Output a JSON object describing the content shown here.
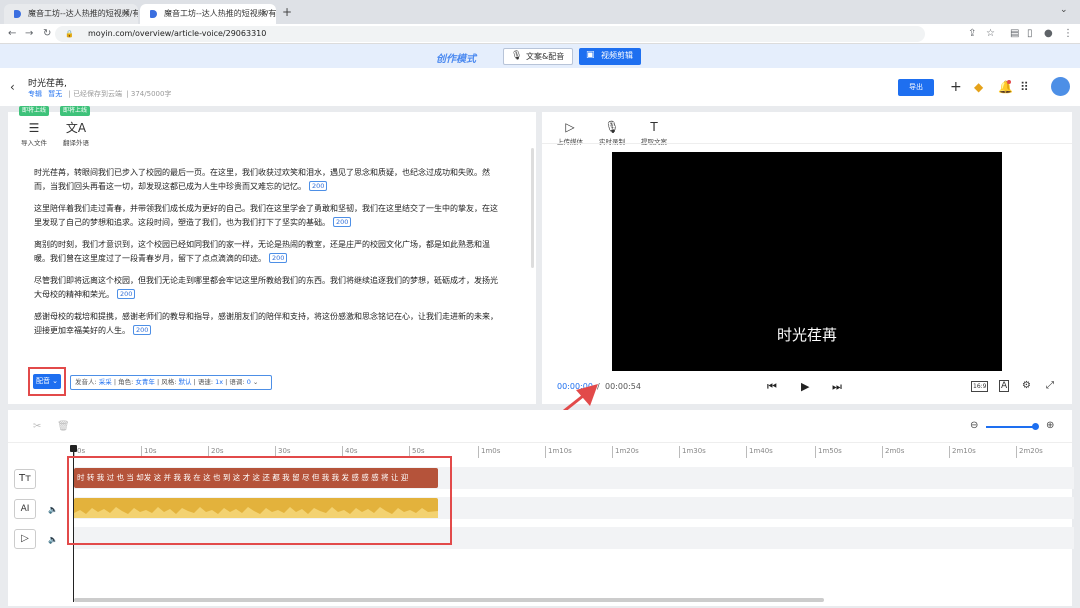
{
  "browser": {
    "tabs": [
      {
        "title": "魔音工坊--达人热推的短视频/有"
      },
      {
        "title": "魔音工坊--达人热推的短视频/有"
      }
    ],
    "new_tab": "+",
    "url": "moyin.com/overview/article-voice/29063310"
  },
  "modebar": {
    "logo": "创作模式",
    "copy_dub": "文案&配音",
    "video_edit": "视频剪辑"
  },
  "header": {
    "title": "时光荏苒,",
    "tag1": "专辑",
    "tag2": "暂无",
    "save_status": "已经保存到云端",
    "char_count": "374/5000字",
    "export": "导出"
  },
  "editor": {
    "badge1": "即将上线",
    "badge2": "即将上线",
    "import": "导入文件",
    "translate": "翻译外语",
    "paragraphs": [
      "时光荏苒，转眼间我们已步入了校园的最后一页。在这里，我们收获过欢笑和泪水，遇见了思念和质疑，也纪念过成功和失败。然而，当我们回头再看这一切，却发现这都已成为人生中珍贵而又难忘的记忆。",
      "这里陪伴着我们走过青春，并带领我们成长成为更好的自己。我们在这里学会了勇敢和坚韧，我们在这里结交了一生中的挚友，在这里发现了自己的梦想和追求。这段时间，塑造了我们，也为我们打下了坚实的基础。",
      "离别的时刻，我们才意识到，这个校园已经如同我们的家一样，无论是热闹的教室，还是庄严的校园文化广场，都是如此熟悉和温暖。我们曾在这里度过了一段青春岁月，留下了点点滴滴的印迹。",
      "尽管我们即将远离这个校园，但我们无论走到哪里都会牢记这里所教给我们的东西。我们将继续追逐我们的梦想，砥砺成才，发扬光大母校的精神和荣光。",
      "感谢母校的栽培和提携，感谢老师们的教导和指导，感谢朋友们的陪伴和支持，将这份感激和思念铭记在心，让我们走进新的未来，迎接更加幸福美好的人生。"
    ],
    "pause_tag": "200",
    "dub_button": "配音",
    "voice": {
      "speaker_label": "发音人:",
      "speaker": "采采",
      "role_label": "角色:",
      "role": "女青年",
      "style_label": "风格:",
      "style": "默认",
      "speed_label": "语速:",
      "speed": "1x",
      "pitch_label": "语调:",
      "pitch": "0"
    }
  },
  "preview": {
    "upload": "上传媒体",
    "record": "实时录制",
    "extract": "提取文案",
    "subtitle": "时光荏苒",
    "current_time": "00:00:00",
    "sep": "/",
    "total_time": "00:00:54",
    "ratio": "16:9"
  },
  "timeline": {
    "ticks": [
      "0s",
      "10s",
      "20s",
      "30s",
      "40s",
      "50s",
      "1m0s",
      "1m10s",
      "1m20s",
      "1m30s",
      "1m40s",
      "1m50s",
      "2m0s",
      "2m10s",
      "2m20s"
    ],
    "text_clip": "时 转 我 过 也 当 却发 这 并 我 我 在 这 也 到 这 才 这 还 都 我 留 尽 但 我 我 发 感 感 感 将 让 迎",
    "side_ai": "AI",
    "side_text": "Tт"
  },
  "colors": {
    "accent": "#1e6ff0",
    "text_clip": "#b5533a",
    "audio_clip": "#e3b23c",
    "annotation": "#e24a4a"
  }
}
